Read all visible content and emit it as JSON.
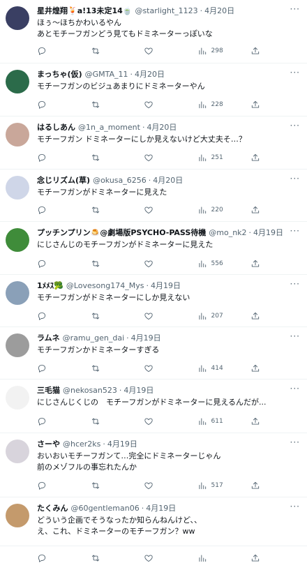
{
  "tweets": [
    {
      "name": "星井煌翔🍹a!13未定14🍵",
      "handle": "@starlight_1123",
      "time": "4月20日",
      "body": "ほぅ～ほちかわいるやん\nあとモチーフガンどう見てもドミネーターっぽいな",
      "views": "298",
      "avatar_color": "#3a3f63"
    },
    {
      "name": "まっちゃ(仮)",
      "handle": "@GMTA_11",
      "time": "4月20日",
      "body": "モチーフガンのビジュあまりにドミネーターやん",
      "views": "228",
      "avatar_color": "#2b6b4a"
    },
    {
      "name": "はるしあん",
      "handle": "@1n_a_moment",
      "time": "4月20日",
      "body": "モチーフガン ドミネーターにしか見えないけど大丈夫そ…？",
      "views": "251",
      "avatar_color": "#c9a79a"
    },
    {
      "name": "念じリズム(草)",
      "handle": "@okusa_6256",
      "time": "4月20日",
      "body": "モチーフガンがドミネーターに見えた",
      "views": "220",
      "avatar_color": "#cfd6e8"
    },
    {
      "name": "プッチンプリン🍮@劇場版PSYCHO-PASS待機",
      "handle": "@mo_nk2",
      "time": "4月19日",
      "body": "にじさんじのモチーフガンがドミネーターに見えた",
      "views": "556",
      "avatar_color": "#3f8c3a"
    },
    {
      "name": "1ﾒﾒｽ🥦",
      "handle": "@Lovesong174_Mys",
      "time": "4月19日",
      "body": "モチーフガンがドミネーターにしか見えない",
      "views": "207",
      "avatar_color": "#8aa0b8"
    },
    {
      "name": "ラムネ",
      "handle": "@ramu_gen_dai",
      "time": "4月19日",
      "body": "モチーフガンかドミネーターすぎる",
      "views": "414",
      "avatar_color": "#9c9c9c"
    },
    {
      "name": "三毛猫",
      "handle": "@nekosan523",
      "time": "4月19日",
      "body": "にじさんじくじの　モチーフガンがドミネーターに見えるんだが...",
      "views": "611",
      "avatar_color": "#f2f2f2"
    },
    {
      "name": "さーや",
      "handle": "@hcer2ks",
      "time": "4月19日",
      "body": "おいおいモチーフガンて…完全にドミネーターじゃん\n前のメゾフルの事忘れたんか",
      "views": "517",
      "avatar_color": "#d8d4dc"
    },
    {
      "name": "たくみん",
      "handle": "@60gentleman06",
      "time": "4月19日",
      "body": "どういう企画でそうなったか知らんねんけど、、\nえ、これ、ドミネーターのモチーフガン？ww",
      "views": "",
      "avatar_color": "#c49a6c"
    }
  ]
}
